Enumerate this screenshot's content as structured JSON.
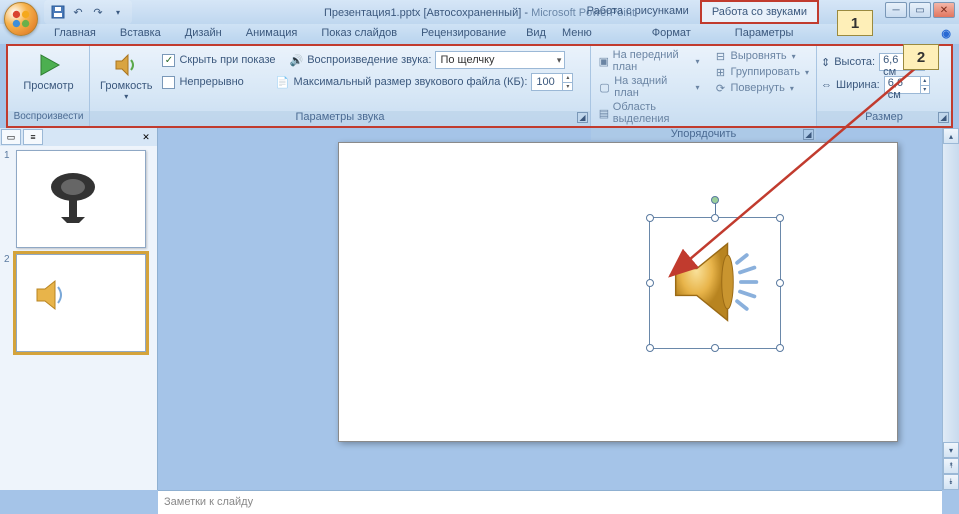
{
  "title": {
    "doc": "Презентация1.pptx [Автосохраненный]",
    "sep": " - ",
    "app": "Microsoft PowerPoint"
  },
  "context_tabs": {
    "pictures": "Работа с рисунками",
    "sounds": "Работа со звуками"
  },
  "callouts": {
    "one": "1",
    "two": "2"
  },
  "tabs": {
    "home": "Главная",
    "insert": "Вставка",
    "design": "Дизайн",
    "anim": "Анимация",
    "show": "Показ слайдов",
    "review": "Рецензирование",
    "view": "Вид",
    "menu": "Меню",
    "format": "Формат",
    "params": "Параметры"
  },
  "ribbon": {
    "play": {
      "preview": "Просмотр",
      "group": "Воспроизвести"
    },
    "volume": "Громкость",
    "opts": {
      "hide": "Скрыть при показе",
      "playback": "Воспроизведение звука:",
      "playback_val": "По щелчку",
      "loop": "Непрерывно",
      "maxsize": "Максимальный размер звукового файла (КБ):",
      "maxsize_val": "100",
      "group": "Параметры звука"
    },
    "arrange": {
      "front": "На передний план",
      "back": "На задний план",
      "selpane": "Область выделения",
      "align": "Выровнять",
      "group": "Группировать",
      "rotate": "Повернуть",
      "grouplabel": "Упорядочить"
    },
    "size": {
      "height": "Высота:",
      "height_val": "6,6 см",
      "width": "Ширина:",
      "width_val": "6,6 см",
      "group": "Размер"
    }
  },
  "thumbs": {
    "n1": "1",
    "n2": "2"
  },
  "notes": "Заметки к слайду"
}
